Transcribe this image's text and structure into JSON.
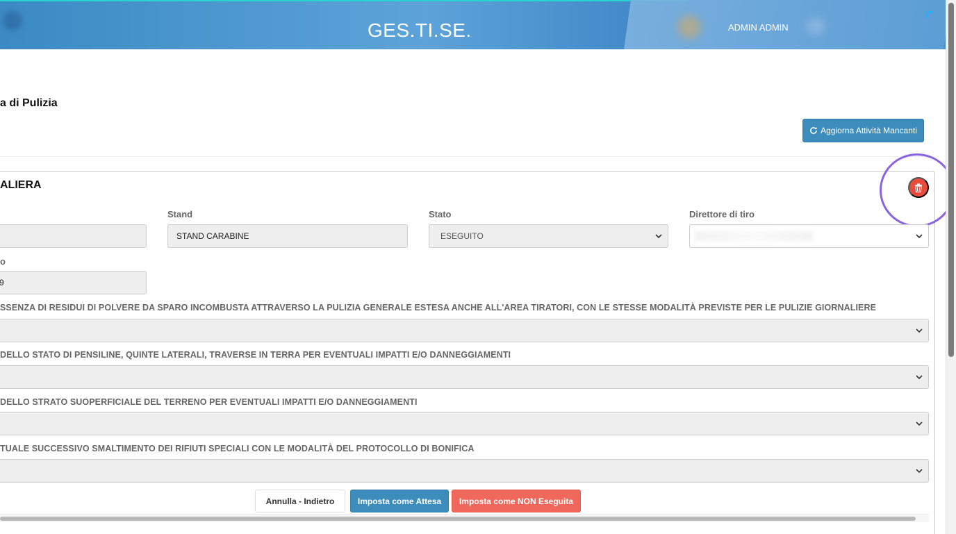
{
  "header": {
    "brand": "GES.TI.SE.",
    "user_name": "ADMIN ADMIN"
  },
  "page": {
    "title_fragment": "a di Pulizia",
    "refresh_button": "Aggiorna Attività Mancanti"
  },
  "panel": {
    "title_fragment": "ALIERA",
    "fields": {
      "stand_label": "Stand",
      "stand_value": "STAND CARABINE",
      "stato_label": "Stato",
      "stato_value": "ESEGUITO",
      "direttore_label": "Direttore di tiro",
      "direttore_value": "",
      "partial_label": "o",
      "partial_value": "9"
    },
    "checklist": [
      {
        "label": "SSENZA DI RESIDUI DI POLVERE DA SPARO INCOMBUSTA ATTRAVERSO LA PULIZIA GENERALE ESTESA ANCHE ALL'AREA TIRATORI, CON LE STESSE MODALITÀ PREVISTE PER LE PULIZIE GIORNALIERE",
        "value": ""
      },
      {
        "label": "DELLO STATO DI PENSILINE, QUINTE LATERALI, TRAVERSE IN TERRA PER EVENTUALI IMPATTI E/O DANNEGGIAMENTI",
        "value": ""
      },
      {
        "label": "DELLO STRATO SUOPERFICIALE DEL TERRENO PER EVENTUALI IMPATTI E/O DANNEGGIAMENTI",
        "value": ""
      },
      {
        "label": "TUALE SUCCESSIVO SMALTIMENTO DEI RIFIUTI SPECIALI CON LE MODALITÀ DEL PROTOCOLLO DI BONIFICA",
        "value": ""
      }
    ],
    "actions": {
      "cancel": "Annulla - Indietro",
      "set_waiting": "Imposta come Attesa",
      "set_not_done": "Imposta come NON Eseguita"
    }
  },
  "colors": {
    "primary": "#3c8dbc",
    "danger": "#e74c3c",
    "highlight": "#8a63e0"
  },
  "icons": [
    "refresh-icon",
    "trash-icon",
    "chevron-down-icon",
    "loading-spinner-icon"
  ]
}
